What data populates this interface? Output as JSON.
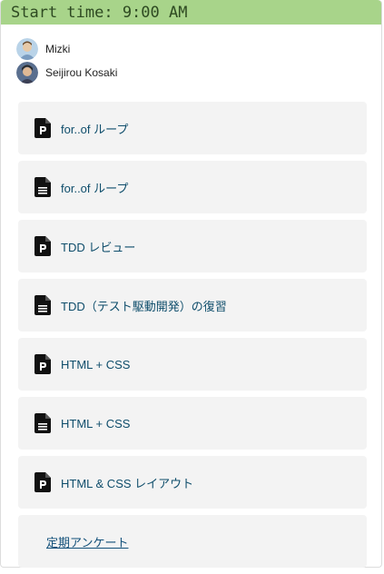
{
  "header": {
    "start_time": "Start time: 9:00 AM"
  },
  "people": [
    {
      "name": "Mizki"
    },
    {
      "name": "Seijirou Kosaki"
    }
  ],
  "items": [
    {
      "icon": "presentation-file-icon",
      "label": "for..of ループ"
    },
    {
      "icon": "document-file-icon",
      "label": "for..of ループ"
    },
    {
      "icon": "presentation-file-icon",
      "label": "TDD レビュー"
    },
    {
      "icon": "document-file-icon",
      "label": "TDD（テスト駆動開発）の復習"
    },
    {
      "icon": "presentation-file-icon",
      "label": "HTML + CSS"
    },
    {
      "icon": "document-file-icon",
      "label": "HTML + CSS"
    },
    {
      "icon": "presentation-file-icon",
      "label": "HTML & CSS レイアウト"
    }
  ],
  "survey_link": {
    "label": "定期アンケート"
  },
  "colors": {
    "header_bg": "#a8d48a",
    "item_bg": "#f3f3f3",
    "link_text": "#0e4d6b"
  }
}
